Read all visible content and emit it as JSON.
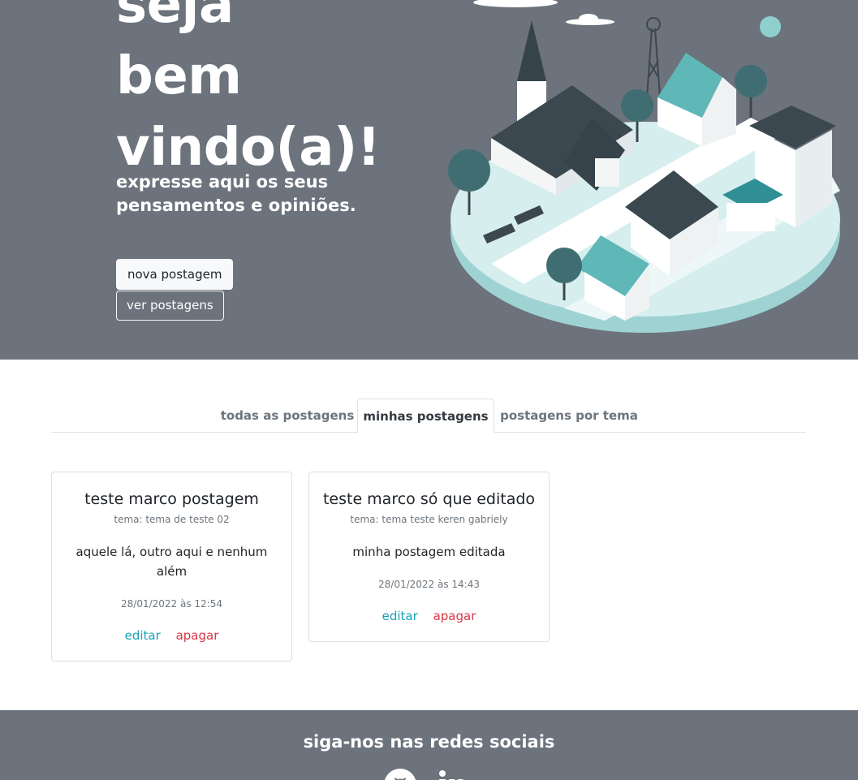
{
  "hero": {
    "title_lines": [
      "seja",
      "bem",
      "vindo(a)!"
    ],
    "subtitle": "expresse aqui os seus pensamentos e opiniões.",
    "new_post_label": "nova postagem",
    "view_posts_label": "ver postagens"
  },
  "tabs": [
    {
      "label": "todas as postagens",
      "active": false
    },
    {
      "label": "minhas postagens",
      "active": true
    },
    {
      "label": "postagens por tema",
      "active": false
    }
  ],
  "posts": [
    {
      "title": "teste marco postagem",
      "theme": "tema: tema de teste 02",
      "text": "aquele lá, outro aqui e nenhum além",
      "date": "28/01/2022 às 12:54",
      "edit_label": "editar",
      "delete_label": "apagar"
    },
    {
      "title": "teste marco só que editado",
      "theme": "tema: tema teste keren gabriely",
      "text": "minha postagem editada",
      "date": "28/01/2022 às 14:43",
      "edit_label": "editar",
      "delete_label": "apagar"
    }
  ],
  "footer": {
    "title": "siga-nos nas redes sociais",
    "icons": [
      "github-icon",
      "linkedin-icon"
    ]
  },
  "colors": {
    "hero_bg": "#6c737c",
    "accent_teal": "#5fb7b8",
    "edit_link": "#17a2b8",
    "delete_link": "#dc3545"
  }
}
